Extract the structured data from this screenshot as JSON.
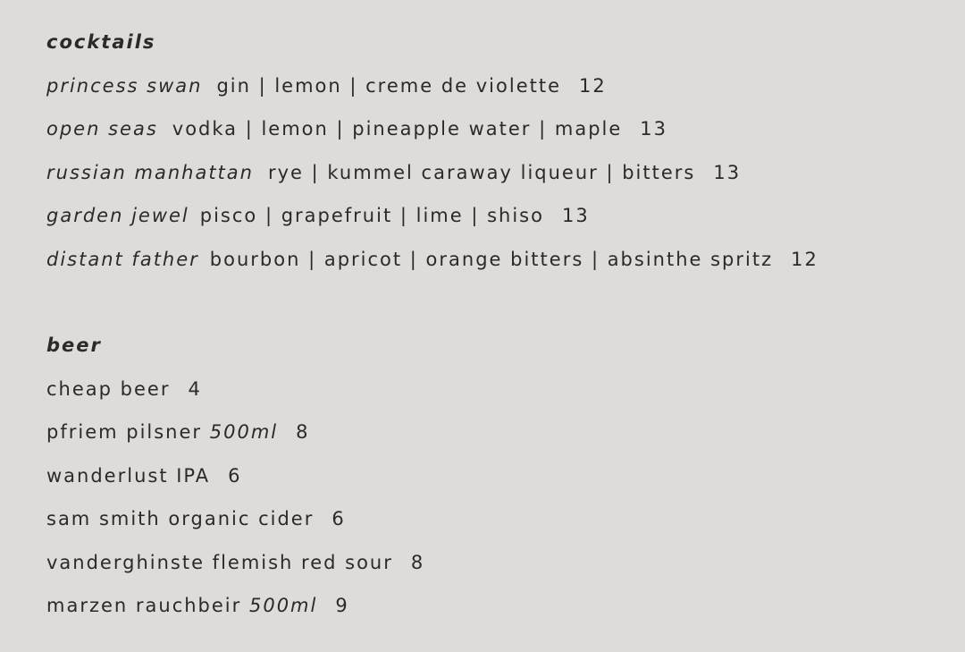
{
  "cocktails": {
    "title": "cocktails",
    "items": [
      {
        "name": "princess swan",
        "ingredients": "gin | lemon | creme de violette",
        "price": "12"
      },
      {
        "name": "open seas",
        "ingredients": "vodka | lemon | pineapple water | maple",
        "price": "13"
      },
      {
        "name": "russian manhattan",
        "ingredients": "rye | kummel caraway liqueur | bitters",
        "price": "13"
      },
      {
        "name": "garden jewel",
        "ingredients": "pisco | grapefruit | lime | shiso",
        "price": "13"
      },
      {
        "name": "distant father",
        "ingredients": "bourbon | apricot | orange bitters | absinthe spritz",
        "price": "12"
      }
    ]
  },
  "beer": {
    "title": "beer",
    "items": [
      {
        "name": "cheap beer",
        "volume": "",
        "price": "4"
      },
      {
        "name": "pfriem pilsner",
        "volume": "500ml",
        "price": "8"
      },
      {
        "name": "wanderlust IPA",
        "volume": "",
        "price": "6"
      },
      {
        "name": "sam smith organic cider",
        "volume": "",
        "price": "6"
      },
      {
        "name": "vanderghinste flemish red sour",
        "volume": "",
        "price": "8"
      },
      {
        "name": "marzen rauchbeir",
        "volume": "500ml",
        "price": "9"
      }
    ]
  }
}
